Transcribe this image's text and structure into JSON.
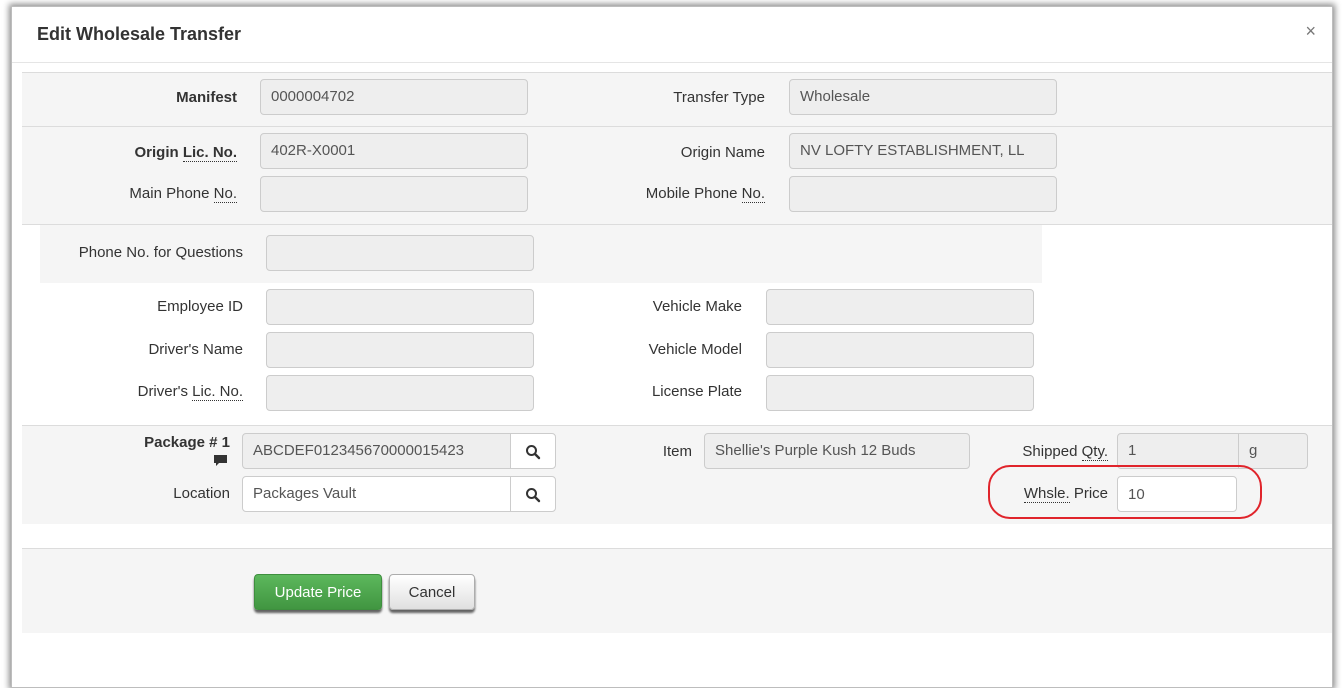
{
  "modal": {
    "title": "Edit Wholesale Transfer",
    "close_glyph": "×"
  },
  "manifest": {
    "manifest_label": "Manifest",
    "manifest_value": "0000004702",
    "transfer_type_label": "Transfer Type",
    "transfer_type_value": "Wholesale"
  },
  "origin": {
    "lic_label": "Origin ",
    "lic_abbr": "Lic. No.",
    "lic_value": "402R-X0001",
    "name_label": "Origin Name",
    "name_value": "NV LOFTY ESTABLISHMENT, LL",
    "main_phone_label": "Main Phone ",
    "main_phone_abbr": "No.",
    "main_phone_value": "",
    "mobile_phone_label": "Mobile Phone ",
    "mobile_phone_abbr": "No.",
    "mobile_phone_value": ""
  },
  "transport": {
    "phone_questions_label": "Phone No. for Questions",
    "phone_questions_value": "",
    "employee_id_label": "Employee ID",
    "employee_id_value": "",
    "driver_name_label": "Driver's Name",
    "driver_name_value": "",
    "driver_lic_label": "Driver's ",
    "driver_lic_abbr": "Lic. No.",
    "driver_lic_value": "",
    "vehicle_make_label": "Vehicle Make",
    "vehicle_make_value": "",
    "vehicle_model_label": "Vehicle Model",
    "vehicle_model_value": "",
    "license_plate_label": "License Plate",
    "license_plate_value": ""
  },
  "package": {
    "package_label": "Package # 1",
    "package_value": "ABCDEF012345670000015423",
    "item_label": "Item",
    "item_value": "Shellie's Purple Kush 12 Buds",
    "shipped_qty_label_abbr": "Qty.",
    "shipped_qty_label": "Shipped ",
    "shipped_qty_value": "1",
    "shipped_unit": "g",
    "location_label": "Location",
    "location_value": "Packages Vault",
    "whsle_price_abbr": "Whsle.",
    "whsle_price_label": " Price",
    "whsle_price_value": "10"
  },
  "actions": {
    "update_label": "Update Price",
    "cancel_label": "Cancel"
  },
  "colors": {
    "primary": "#5cb85c",
    "highlight": "#e0242b"
  }
}
